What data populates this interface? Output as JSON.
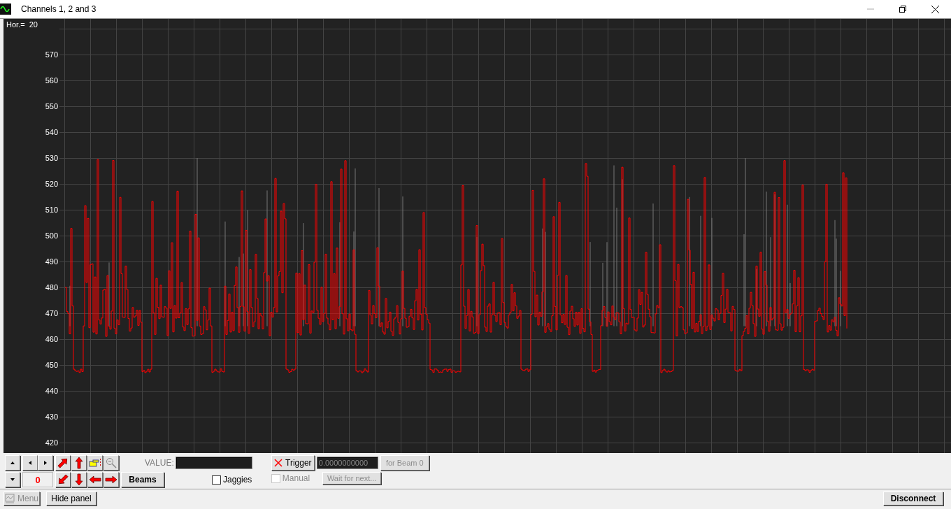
{
  "window": {
    "title": "Channels 1, 2 and 3"
  },
  "plot": {
    "horizontal_label": "Hor.=",
    "horizontal_value": "20",
    "y_axis_labels": [
      "570",
      "560",
      "550",
      "540",
      "530",
      "520",
      "510",
      "500",
      "490",
      "480",
      "470",
      "460",
      "450",
      "440",
      "430",
      "420"
    ]
  },
  "controls": {
    "offset_value": "0",
    "beams_button": "Beams",
    "value_label": "VALUE:",
    "jaggies": {
      "label": "Jaggies",
      "checked": false
    },
    "trigger_button": "Trigger",
    "trigger_value": "0.0000000000",
    "for_beam_button": {
      "label": "for Beam 0",
      "disabled": true
    },
    "manual": {
      "label": "Manual",
      "checked": false,
      "disabled": true
    },
    "wait_button": {
      "label": "Wait for next...",
      "disabled": true
    }
  },
  "bottom_bar": {
    "menu_button": {
      "label": "Menu",
      "disabled": true
    },
    "hide_panel_button": "Hide panel",
    "disconnect_button": "Disconnect"
  }
}
